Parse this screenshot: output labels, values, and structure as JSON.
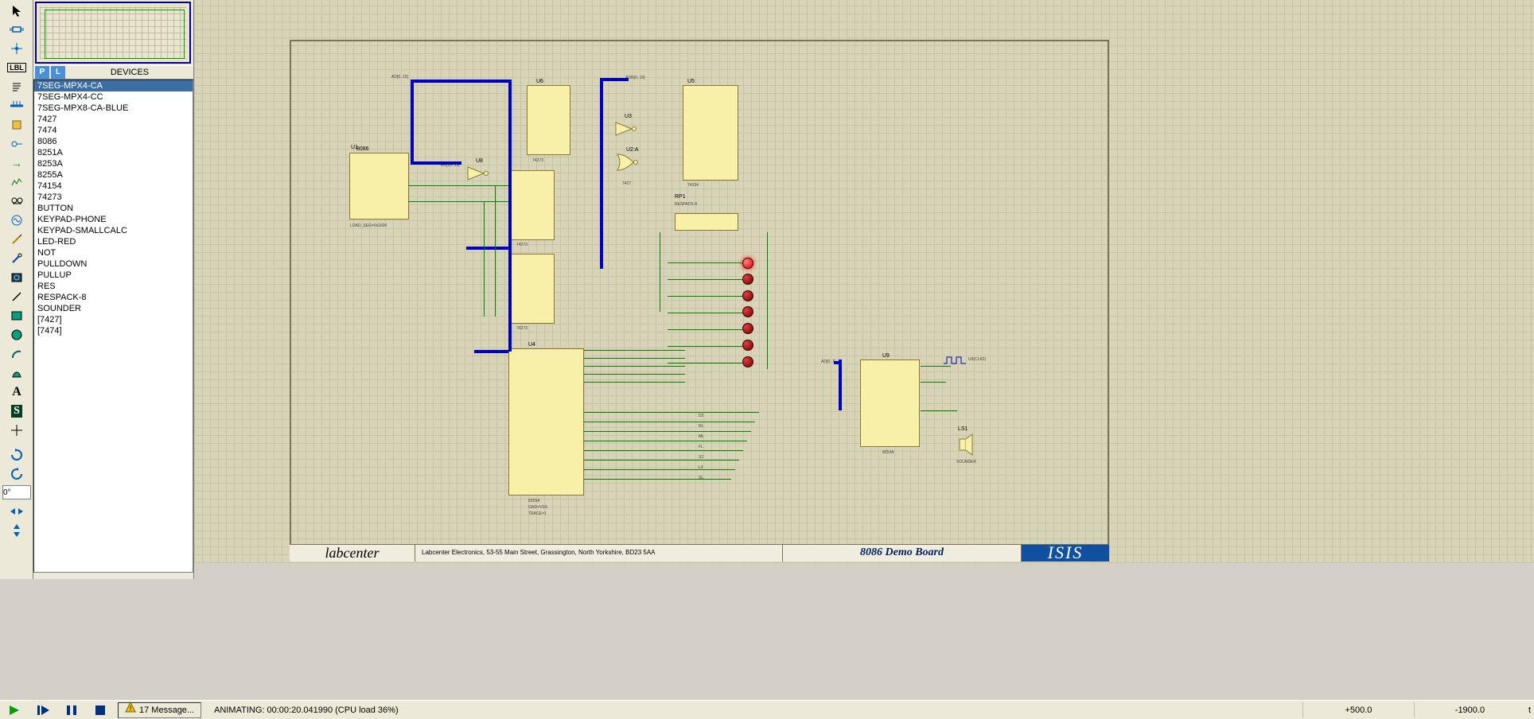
{
  "toolbar_icons": [
    "selection",
    "component",
    "junction",
    "label",
    "script",
    "bus-entry",
    "sub-circuit",
    "terminal",
    "device-pin",
    "graph",
    "tape",
    "generator",
    "probe-v",
    "probe-i",
    "meter",
    "wire",
    "rectangle",
    "circle",
    "arc",
    "path",
    "text",
    "symbol",
    "origin",
    "rotate-cw",
    "rotate-ccw",
    "flip-h",
    "flip-v"
  ],
  "rotation_value": "0°",
  "devices_header": {
    "p_btn": "P",
    "l_btn": "L",
    "title": "DEVICES"
  },
  "devices": [
    "7SEG-MPX4-CA",
    "7SEG-MPX4-CC",
    "7SEG-MPX8-CA-BLUE",
    "7427",
    "7474",
    "8086",
    "8251A",
    "8253A",
    "8255A",
    "74154",
    "74273",
    "BUTTON",
    "KEYPAD-PHONE",
    "KEYPAD-SMALLCALC",
    "LED-RED",
    "NOT",
    "PULLDOWN",
    "PULLUP",
    "RES",
    "RESPACK-8",
    "SOUNDER",
    "[7427]",
    "[7474]"
  ],
  "selected_device_index": 0,
  "schematic": {
    "components": {
      "U1": "8086",
      "U2A": "7427",
      "U3": "NOT",
      "U4": "8255A",
      "U5": "74154",
      "U6": "74273",
      "U7": "74273",
      "U8": "NOT",
      "U9": "8253A",
      "U10": "74273",
      "RP1": "RESPACK-8",
      "LS1": "SOUNDER"
    },
    "u1_caption": "LOAD_SEG=0x2000",
    "u4_caption1": "8255A",
    "u4_caption2": "GND=VSS",
    "u4_caption3": "TRACE=1",
    "clock_label": "U9(CLK2)",
    "bus_labels": [
      "AD[0..15]",
      "AD[16..19]",
      "ADR[0..19]",
      "AD[0..7]",
      "AD[0..7]"
    ],
    "led_labels": [
      "D2",
      "RL",
      "ML",
      "FL",
      "S2",
      "L4",
      "SL"
    ]
  },
  "title_block": {
    "logo": "labcenter",
    "address": "Labcenter Electronics,    53-55 Main Street,    Grassington,    North Yorkshire,    BD23 5AA",
    "board_name": "8086 Demo Board",
    "logo2": "ISIS"
  },
  "status": {
    "messages": "17 Message...",
    "animating": "ANIMATING: 00:00:20.041990 (CPU load 36%)",
    "coord_x": "+500.0",
    "coord_y": "-1900.0",
    "coord_unit": "t"
  },
  "sim_buttons": [
    "play",
    "step",
    "pause",
    "stop"
  ]
}
